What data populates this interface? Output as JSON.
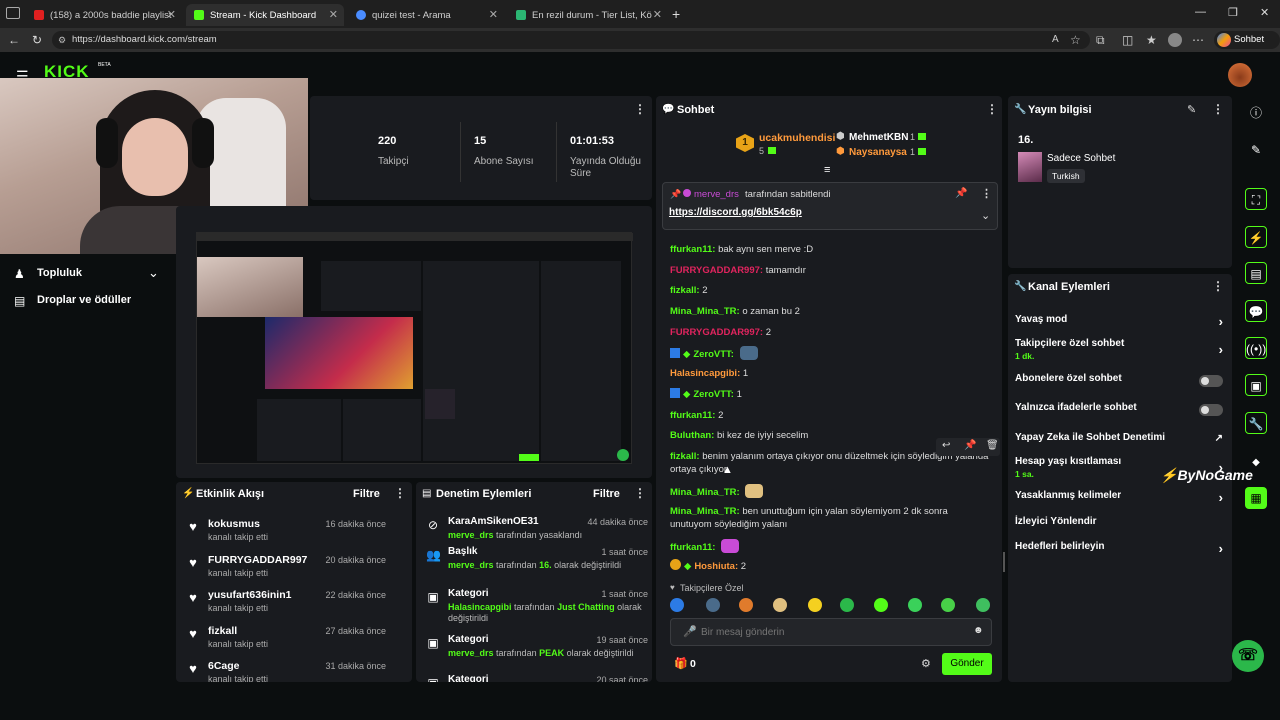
{
  "browser": {
    "tabs": [
      {
        "title": "(158) a 2000s baddie playlist",
        "fav": "#e02020"
      },
      {
        "title": "Stream - Kick Dashboard",
        "fav": "#53fc18"
      },
      {
        "title": "quizei test - Arama",
        "fav": "#4a8cff"
      },
      {
        "title": "En rezil durum - Tier List, Kör Sıralı",
        "fav": "#2bb673"
      }
    ],
    "url": "https://dashboard.kick.com/stream",
    "profile_button": "Sohbet et"
  },
  "header": {
    "logo": "KICK",
    "beta": "BETA"
  },
  "stats": [
    {
      "value": "220",
      "label": "Takipçi"
    },
    {
      "value": "15",
      "label": "Abone Sayısı"
    },
    {
      "value": "01:01:53",
      "label": "Yayında Olduğu Süre"
    }
  ],
  "sidebar": {
    "items": [
      {
        "label": "Topluluk"
      },
      {
        "label": "Droplar ve ödüller"
      }
    ]
  },
  "activity": {
    "title": "Etkinlik Akışı",
    "filter": "Filtre",
    "items": [
      {
        "name": "kokusmus",
        "sub": "kanalı takip etti",
        "time": "16 dakika önce"
      },
      {
        "name": "FURRYGADDAR997",
        "sub": "kanalı takip etti",
        "time": "20 dakika önce"
      },
      {
        "name": "yusufart636inin1",
        "sub": "kanalı takip etti",
        "time": "22 dakika önce"
      },
      {
        "name": "fizkall",
        "sub": "kanalı takip etti",
        "time": "27 dakika önce"
      },
      {
        "name": "6Cage",
        "sub": "kanalı takip etti",
        "time": "31 dakika önce"
      }
    ]
  },
  "moderation": {
    "title": "Denetim Eylemleri",
    "filter": "Filtre",
    "items": [
      {
        "icon": "ban-icon",
        "glyph": "⊘",
        "name": "KaraAmSikenOE31",
        "actor": "merve_drs",
        "text": " tarafından yasaklandı",
        "highlight": "",
        "tail": "",
        "time": "44 dakika önce"
      },
      {
        "icon": "users-icon",
        "glyph": "👥",
        "name": "Başlık",
        "actor": "merve_drs",
        "text": " tarafından ",
        "highlight": "16.",
        "tail": " olarak değiştirildi",
        "time": "1 saat önce"
      },
      {
        "icon": "category-icon",
        "glyph": "▣",
        "name": "Kategori",
        "actor": "Halasincapgibi",
        "text": " tarafından ",
        "highlight": "Just Chatting",
        "tail": " olarak değiştirildi",
        "time": "1 saat önce"
      },
      {
        "icon": "category-icon",
        "glyph": "▣",
        "name": "Kategori",
        "actor": "merve_drs",
        "text": " tarafından ",
        "highlight": "PEAK",
        "tail": " olarak değiştirildi",
        "time": "19 saat önce"
      },
      {
        "icon": "category-icon",
        "glyph": "▣",
        "name": "Kategori",
        "actor": "",
        "text": "",
        "highlight": "",
        "tail": "",
        "time": "20 saat önce"
      }
    ]
  },
  "chat": {
    "title": "Sohbet",
    "leaderboard": [
      {
        "rank": "1",
        "name": "ucakmuhendisi",
        "count": "5"
      },
      {
        "name": "MehmetKBN",
        "count": "1"
      },
      {
        "name": "Naysanaysa",
        "count": "1"
      }
    ],
    "pinned": {
      "by": "merve_drs",
      "by_suffix": "tarafından sabitlendi",
      "link": "https://discord.gg/6bk54c6p"
    },
    "messages": [
      {
        "user": "ffurkan11",
        "color": "#53fc18",
        "text": "bak aynı sen merve :D"
      },
      {
        "user": "FURRYGADDAR997",
        "color": "#e0245e",
        "text": "tamamdır"
      },
      {
        "user": "fizkall",
        "color": "#53fc18",
        "text": "2"
      },
      {
        "user": "Mina_Mina_TR",
        "color": "#53fc18",
        "text": "o zaman bu 2"
      },
      {
        "user": "FURRYGADDAR997",
        "color": "#e0245e",
        "text": "2"
      },
      {
        "user": "ZeroVTT",
        "color": "#53fc18",
        "text": ""
      },
      {
        "user": "Halasincapgibi",
        "color": "#ff9a3c",
        "text": "1"
      },
      {
        "user": "ZeroVTT",
        "color": "#53fc18",
        "text": "1"
      },
      {
        "user": "ffurkan11",
        "color": "#53fc18",
        "text": "2"
      },
      {
        "user": "Buluthan",
        "color": "#53fc18",
        "text": "bi kez de iyiyi secelim"
      },
      {
        "user": "fizkall",
        "color": "#53fc18",
        "text": "benim yalanım ortaya çıkıyor onu düzeltmek için söyledigim yalanda ortaya çıkıyor"
      },
      {
        "user": "Mina_Mina_TR",
        "color": "#53fc18",
        "text": ""
      },
      {
        "user": "Mina_Mina_TR",
        "color": "#53fc18",
        "text": "ben unuttuğum için yalan söylemiyom 2 dk sonra unutuyom söylediğim yalanı"
      },
      {
        "user": "ffurkan11",
        "color": "#53fc18",
        "text": ""
      },
      {
        "user": "Hoshiuta",
        "color": "#ff9a3c",
        "text": "2"
      }
    ],
    "followers_only": "Takipçilere Özel",
    "input_placeholder": "Bir mesaj gönderin",
    "points": "0",
    "send": "Gönder"
  },
  "stream_info": {
    "title": "Yayın bilgisi",
    "stream_title": "16.",
    "category": "Sadece Sohbet",
    "tag": "Turkish"
  },
  "channel_actions": {
    "title": "Kanal Eylemleri",
    "slow_mode": "Yavaş mod",
    "followers_chat": "Takipçilere özel sohbet",
    "followers_chat_sub": "1 dk.",
    "subs_chat": "Abonelere özel sohbet",
    "emotes_chat": "Yalnızca ifadelerle sohbet",
    "ai_mod": "Yapay Zeka ile Sohbet Denetimi",
    "age_limit": "Hesap yaşı kısıtlaması",
    "age_limit_sub": "1 sa.",
    "banned_words": "Yasaklanmış kelimeler",
    "viewer_redirect": "İzleyici Yönlendir",
    "goals": "Hedefleri belirleyin"
  },
  "watermark": "ByNoGame",
  "colors": {
    "accent": "#53fc18",
    "panel": "#191b1f",
    "bg": "#0b0e0f"
  }
}
